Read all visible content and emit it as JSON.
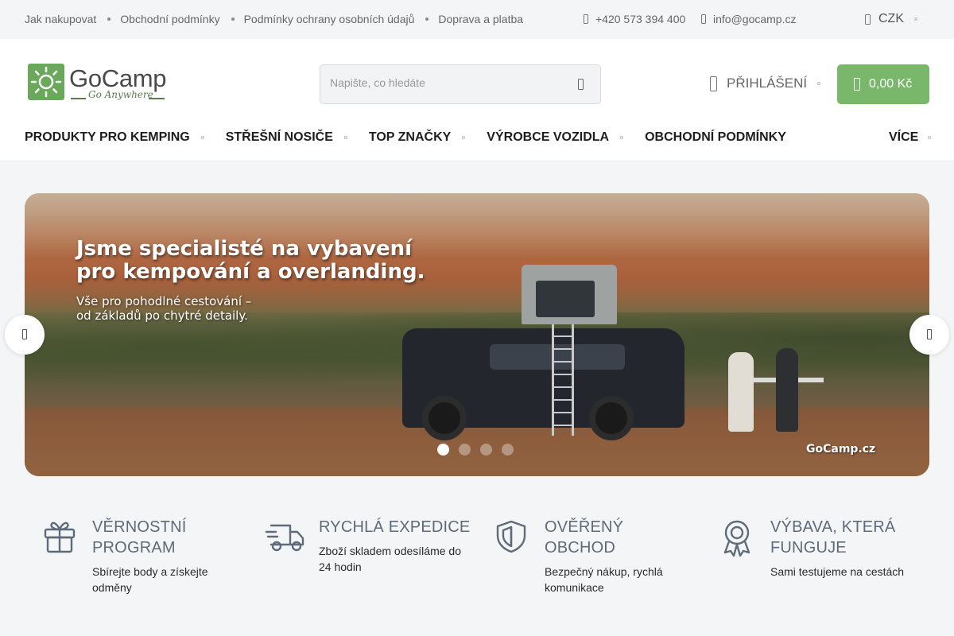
{
  "topbar": {
    "links": [
      "Jak nakupovat",
      "Obchodní podmínky",
      "Podmínky ochrany osobních údajů",
      "Doprava a platba"
    ],
    "phone": "+420 573 394 400",
    "phone_icon": "phone-icon",
    "email": "info@gocamp.cz",
    "email_icon": "mail-icon",
    "currency": "CZK",
    "currency_icon": "currency-icon"
  },
  "header": {
    "logo_name": "GoCamp",
    "logo_slogan": "Go Anywhere",
    "search_placeholder": "Napište, co hledáte",
    "search_icon": "search-icon",
    "login_label": "PŘIHLÁŠENÍ",
    "login_icon": "user-icon",
    "cart_total": "0,00 Kč",
    "cart_icon": "cart-icon"
  },
  "nav": {
    "items": [
      "PRODUKTY PRO KEMPING",
      "STŘEŠNÍ NOSIČE",
      "TOP ZNAČKY",
      "VÝROBCE VOZIDLA",
      "OBCHODNÍ PODMÍNKY"
    ],
    "more_label": "VÍCE"
  },
  "banner": {
    "headline_line1": "Jsme specialisté na vybavení",
    "headline_line2": "pro kempování a overlanding.",
    "sub_line1": "Vše pro pohodlné cestování –",
    "sub_line2": "od základů po chytré detaily.",
    "watermark": "GoCamp.cz",
    "slides": 4,
    "active_slide": 1,
    "prev_icon": "chevron-left-icon",
    "next_icon": "chevron-right-icon"
  },
  "benefits": [
    {
      "icon": "gift-icon",
      "title_line1": "VĚRNOSTNÍ",
      "title_line2": "PROGRAM",
      "desc_line1": "Sbírejte body a získejte",
      "desc_line2": "odměny"
    },
    {
      "icon": "truck-icon",
      "title_line1": "RYCHLÁ EXPEDICE",
      "title_line2": "",
      "desc_line1": "Zboží skladem odesíláme do",
      "desc_line2": "24 hodin"
    },
    {
      "icon": "shield-icon",
      "title_line1": "OVĚŘENÝ",
      "title_line2": "OBCHOD",
      "desc_line1": "Bezpečný nákup, rychlá",
      "desc_line2": "komunikace"
    },
    {
      "icon": "award-icon",
      "title_line1": "VÝBAVA, KTERÁ",
      "title_line2": "FUNGUJE",
      "desc_line1": "Sami testujeme na cestách",
      "desc_line2": ""
    }
  ],
  "colors": {
    "accent_green": "#79b86a",
    "benefit_title": "#5d6b7a",
    "topbar_bg": "#f4f5f6"
  }
}
